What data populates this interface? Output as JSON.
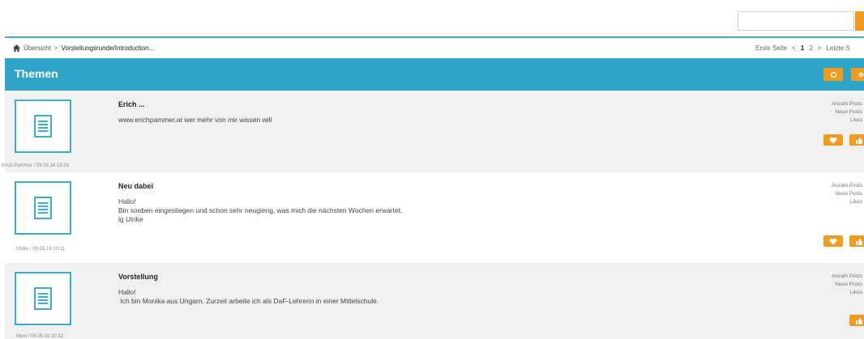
{
  "search": {
    "placeholder": ""
  },
  "breadcrumb": {
    "home": "Übersicht",
    "separator": ">",
    "current": "Vorstellungsrunde/Introduction..."
  },
  "pager": {
    "first": "Erste Seite",
    "prev": "<",
    "page1": "1",
    "page2": "2",
    "next": ">",
    "last": "Letzte S"
  },
  "header": {
    "title": "Themen"
  },
  "colors": {
    "accent": "#2fa6c8",
    "button": "#f29a1e"
  },
  "topics": [
    {
      "title": "Erich ...",
      "body": "www.erichpammer.at wer mehr von mir wissen will",
      "meta": "Erich Pammer / 09.05.16 19:23",
      "stat1": "Anzahl Posts",
      "stat2": "Neue Posts",
      "stat3": "Likes"
    },
    {
      "title": "Neu dabei",
      "body": "Hallo!\nBin soeben eingestiegen und schon sehr neugierig, was mich die nächsten Wochen erwartet.\nlg Ulrike",
      "meta": "Ulrike / 09.05.16 20:11",
      "stat1": "Anzahl Posts",
      "stat2": "Neue Posts",
      "stat3": "Likes"
    },
    {
      "title": "Vorstellung",
      "body": "Hallo!\n Ich bin Monika aus Ungarn. Zurzeit arbeite ich als DaF-Lehrerin in einer Mittelschule.",
      "meta": "Moni / 09.05.16 20:32",
      "stat1": "Anzahl Posts",
      "stat2": "Neue Posts",
      "stat3": "Likes"
    }
  ]
}
